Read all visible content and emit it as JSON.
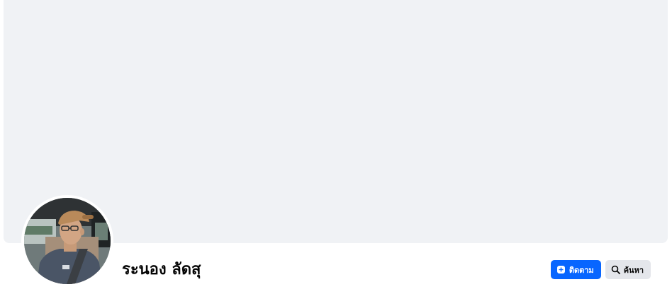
{
  "profile": {
    "name": "ระนอง ลัดสุ"
  },
  "actions": {
    "follow_label": "ติดตาม",
    "search_label": "ค้นหา"
  },
  "icons": {
    "follow": "follow-plus-icon",
    "search": "search-icon"
  },
  "colors": {
    "cover_bg": "#f0f2f5",
    "primary": "#0866ff",
    "secondary_button": "#e4e6eb"
  }
}
